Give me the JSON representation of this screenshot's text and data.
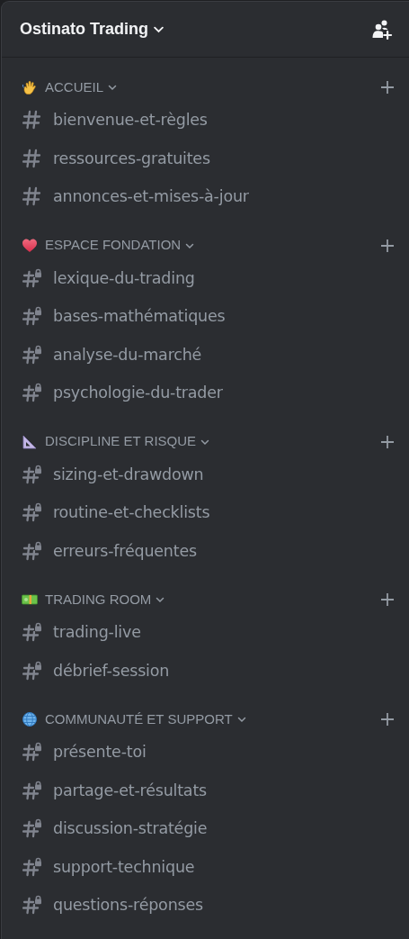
{
  "server": {
    "name": "Ostinato Trading"
  },
  "categories": [
    {
      "name": "ACCUEIL",
      "channels": [
        {
          "name": "bienvenue-et-règles",
          "locked": false
        },
        {
          "name": "ressources-gratuites",
          "locked": false
        },
        {
          "name": "annonces-et-mises-à-jour",
          "locked": false
        }
      ]
    },
    {
      "name": "ESPACE FONDATION",
      "channels": [
        {
          "name": "lexique-du-trading",
          "locked": true
        },
        {
          "name": "bases-mathématiques",
          "locked": true
        },
        {
          "name": "analyse-du-marché",
          "locked": true
        },
        {
          "name": "psychologie-du-trader",
          "locked": true
        }
      ]
    },
    {
      "name": "DISCIPLINE ET RISQUE",
      "channels": [
        {
          "name": "sizing-et-drawdown",
          "locked": true
        },
        {
          "name": "routine-et-checklists",
          "locked": true
        },
        {
          "name": "erreurs-fréquentes",
          "locked": true
        }
      ]
    },
    {
      "name": "TRADING ROOM",
      "channels": [
        {
          "name": "trading-live",
          "locked": true
        },
        {
          "name": "débrief-session",
          "locked": true
        }
      ]
    },
    {
      "name": "COMMUNAUTÉ ET SUPPORT",
      "channels": [
        {
          "name": "présente-toi",
          "locked": true
        },
        {
          "name": "partage-et-résultats",
          "locked": true
        },
        {
          "name": "discussion-stratégie",
          "locked": true
        },
        {
          "name": "support-technique",
          "locked": true
        },
        {
          "name": "questions-réponses",
          "locked": true
        }
      ]
    }
  ]
}
